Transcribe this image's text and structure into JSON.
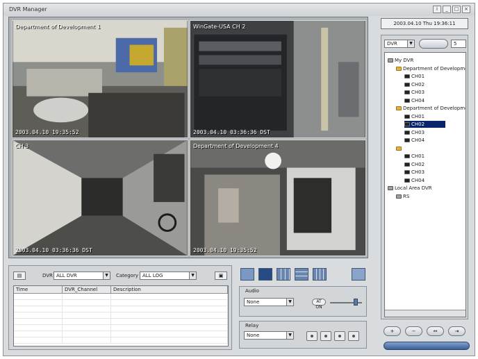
{
  "window": {
    "title": "DVR Manager",
    "buttons": [
      "i",
      "_",
      "□",
      "×"
    ]
  },
  "datetime": "2003.04.10  Thu  19:36:11",
  "cameras": [
    {
      "label": "Department of Development 1",
      "time": "2003.04.10 19:35:52"
    },
    {
      "label": "WinGate-USA CH 2",
      "time": "2003.04.10 03:36:36 DST"
    },
    {
      "label": "CH 3",
      "time": "2003.04.10 03:36:36 DST"
    },
    {
      "label": "Department of Development 4",
      "time": "2003.04.10 19:35:52"
    }
  ],
  "log": {
    "dvr_label": "DVR",
    "dvr_value": "ALL DVR",
    "category_label": "Category",
    "category_value": "ALL LOG",
    "columns": [
      "Time",
      "DVR_Channel",
      "Description"
    ]
  },
  "controls": {
    "audio_label": "Audio",
    "audio_value": "None",
    "audio_toggle": "AT ON",
    "relay_label": "Relay",
    "relay_value": "None"
  },
  "side": {
    "dvr_select": "DVR",
    "spin_value": "5",
    "tree": [
      {
        "text": "My DVR",
        "level": 0,
        "icon": "pc-icon"
      },
      {
        "text": "Department of Development",
        "level": 1,
        "icon": "folder-icon"
      },
      {
        "text": "CH01",
        "level": 2,
        "icon": "cam-icon"
      },
      {
        "text": "CH02",
        "level": 2,
        "icon": "cam-icon"
      },
      {
        "text": "CH03",
        "level": 2,
        "icon": "cam-icon"
      },
      {
        "text": "CH04",
        "level": 2,
        "icon": "cam-icon"
      },
      {
        "text": "Department of Development",
        "level": 1,
        "icon": "folder-icon"
      },
      {
        "text": "CH01",
        "level": 2,
        "icon": "cam-icon"
      },
      {
        "text": "CH02",
        "level": 2,
        "icon": "cam-icon",
        "selected": true
      },
      {
        "text": "CH03",
        "level": 2,
        "icon": "cam-icon"
      },
      {
        "text": "CH04",
        "level": 2,
        "icon": "cam-icon"
      },
      {
        "text": "",
        "level": 1,
        "icon": "folder-icon"
      },
      {
        "text": "CH01",
        "level": 2,
        "icon": "cam-icon"
      },
      {
        "text": "CH02",
        "level": 2,
        "icon": "cam-icon"
      },
      {
        "text": "CH03",
        "level": 2,
        "icon": "cam-icon"
      },
      {
        "text": "CH04",
        "level": 2,
        "icon": "cam-icon"
      },
      {
        "text": "Local Area DVR",
        "level": 0,
        "icon": "pc-icon"
      },
      {
        "text": "RS",
        "level": 1,
        "icon": "pc-icon"
      }
    ]
  }
}
